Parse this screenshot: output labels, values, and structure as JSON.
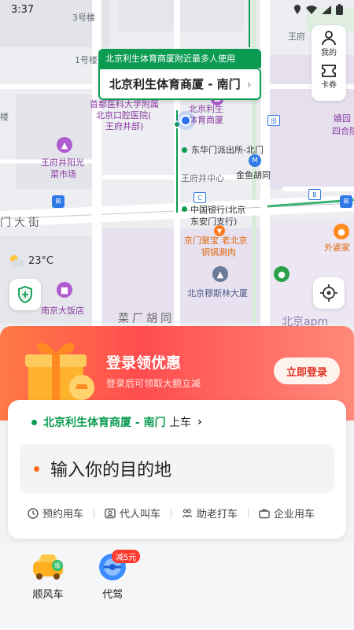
{
  "status_bar": {
    "time": "3:37"
  },
  "map": {
    "labels": {
      "bldg3": "3号楼",
      "bldg1": "1号楼",
      "wfj_tl": "王府井",
      "wfj_tl2": "王府",
      "lou": "楼",
      "wangfu_right": "王府",
      "hospital_a": "首都医科大学附属",
      "hospital_b": "北京口腔医院(",
      "hospital_c": "王府井部)",
      "sports_a": "北京利生",
      "sports_b": "体育商厦",
      "market_a": "王府井阳光",
      "market_b": "菜市场",
      "police": "东华门派出所-北门",
      "wfj_center": "王府井中心",
      "jinyu": "金鱼胡同",
      "bank_a": "中国银行(北京",
      "bank_b": "东安门支行)",
      "street": "门大街",
      "jingmen_a": "京门聚宝 老北京",
      "jingmen_b": "铜锅涮肉",
      "waipojia": "外婆家",
      "mosque": "北京穆斯林大厦",
      "nanjing": "南京大饭店",
      "lane": "菜厂胡同",
      "apm": "北京apm",
      "dengshi_a": "嬉园",
      "dengshi_b": "四合院",
      "chu": "出"
    },
    "pickup_hint": "北京利生体育商厦附近最多人使用",
    "pickup_name": "北京利生体育商厦 - 南门"
  },
  "side_panel": {
    "mine": "我的",
    "coupons": "卡券"
  },
  "weather": {
    "temp": "23°C"
  },
  "promo": {
    "title": "登录领优惠",
    "subtitle": "登录后可领取大额立减",
    "login_button": "立即登录"
  },
  "booking": {
    "pickup_name": "北京利生体育商厦 - 南门",
    "pickup_suffix": "上车",
    "destination_placeholder": "输入你的目的地",
    "quick_actions": [
      "预约用车",
      "代人叫车",
      "助老打车",
      "企业用车"
    ]
  },
  "services": {
    "carpool": "顺风车",
    "designated_driver": "代驾",
    "driver_badge": "减5元"
  },
  "colors": {
    "brand_green": "#0c9b52",
    "promo_red": "#ff4d4f",
    "dest_dot": "#ff6a1a"
  }
}
